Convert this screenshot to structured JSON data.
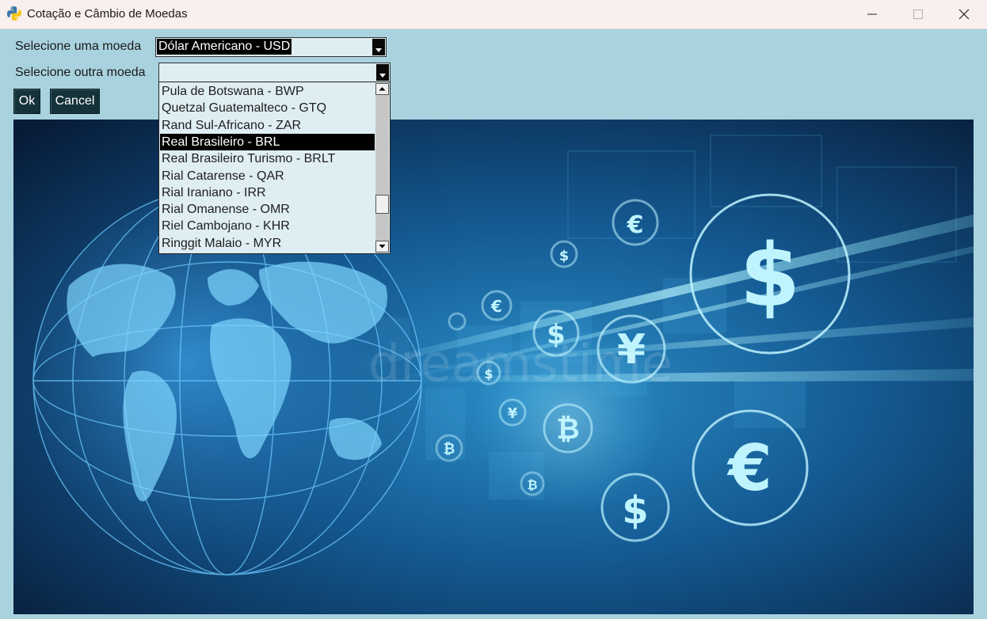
{
  "window": {
    "title": "Cotação e Câmbio de Moedas",
    "controls": [
      "minimize",
      "maximize",
      "close"
    ]
  },
  "form": {
    "first_currency_label": "Selecione uma moeda",
    "first_currency_value": "Dólar Americano - USD",
    "second_currency_label": "Selecione outra moeda",
    "second_currency_value": "",
    "ok_label": "Ok",
    "cancel_label": "Cancel"
  },
  "dropdown": {
    "items": [
      {
        "label": "Pula de Botswana - BWP",
        "selected": false
      },
      {
        "label": "Quetzal Guatemalteco - GTQ",
        "selected": false
      },
      {
        "label": "Rand Sul-Africano - ZAR",
        "selected": false
      },
      {
        "label": "Real Brasileiro - BRL",
        "selected": true
      },
      {
        "label": "Real Brasileiro Turismo - BRLT",
        "selected": false
      },
      {
        "label": "Rial Catarense - QAR",
        "selected": false
      },
      {
        "label": "Rial Iraniano - IRR",
        "selected": false
      },
      {
        "label": "Rial Omanense - OMR",
        "selected": false
      },
      {
        "label": "Riel Cambojano - KHR",
        "selected": false
      },
      {
        "label": "Ringgit Malaio - MYR",
        "selected": false
      }
    ]
  },
  "banner": {
    "watermark": "dreamstime",
    "symbols": [
      "$",
      "€",
      "¥",
      "₿"
    ]
  },
  "colors": {
    "background": "#a9d2df",
    "titlebar": "#f9efef",
    "button": "#15323a",
    "selection": "#000000"
  }
}
